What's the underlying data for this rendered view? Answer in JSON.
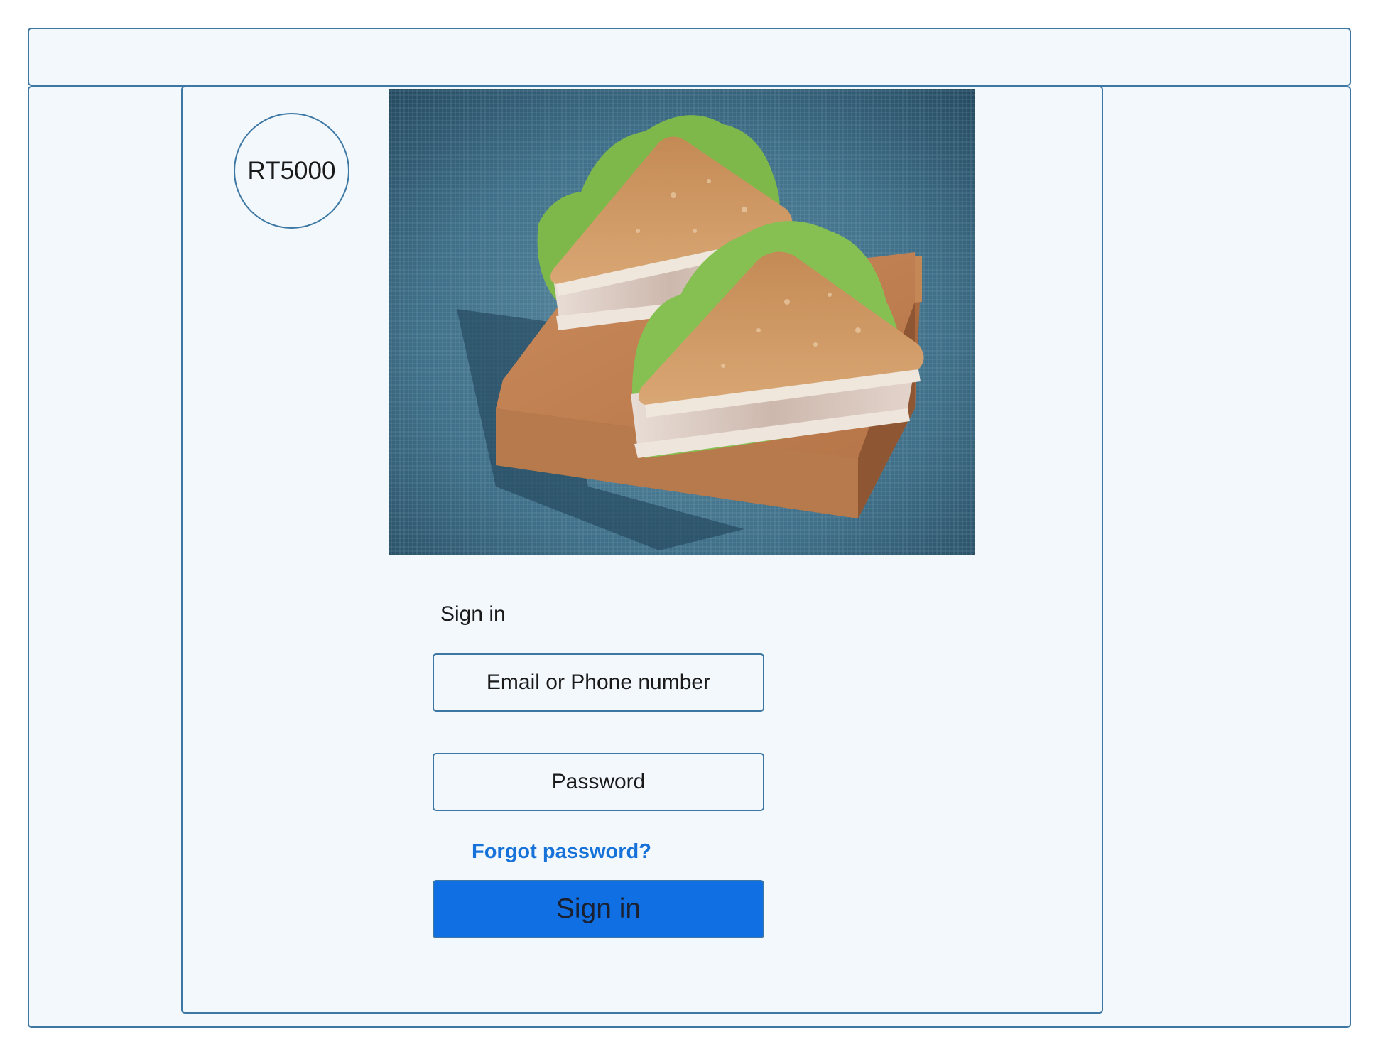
{
  "logo": {
    "text": "RT5000"
  },
  "hero": {
    "image": "sandwich-photo"
  },
  "form": {
    "heading": "Sign in",
    "email_placeholder": "Email or Phone number",
    "password_placeholder": "Password",
    "forgot_label": "Forgot password?",
    "submit_label": "Sign in"
  },
  "colors": {
    "frame_border": "#3d77a3",
    "panel_bg": "#f2f8fc",
    "button_bg": "#0f6fe3",
    "link": "#1672d9"
  }
}
